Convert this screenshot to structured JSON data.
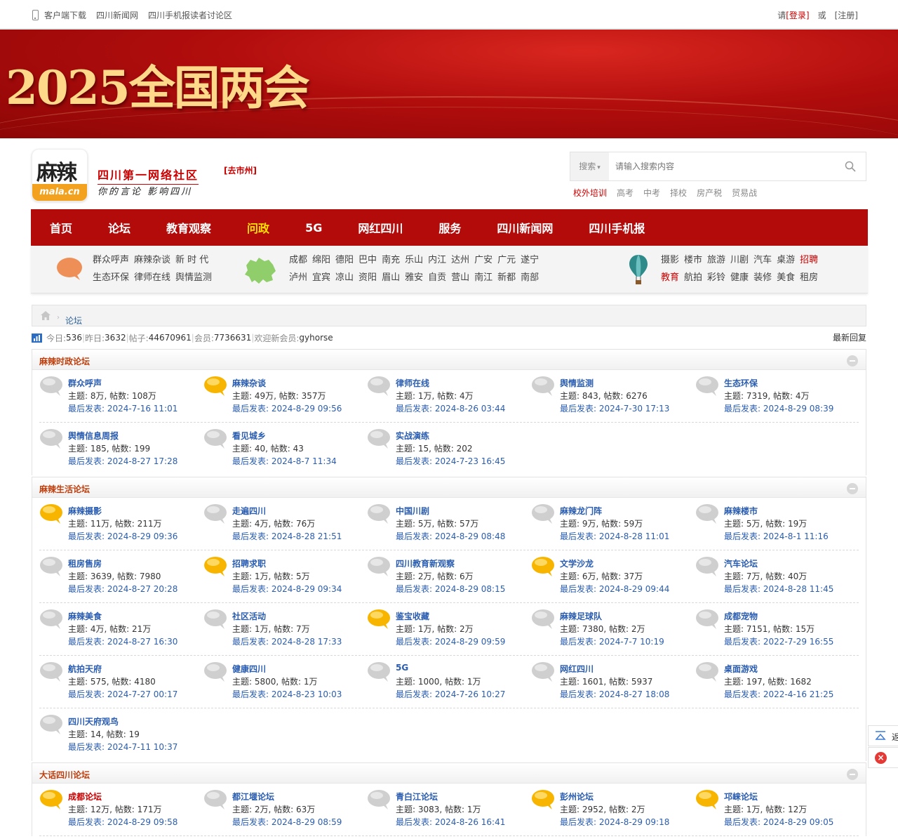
{
  "topbar": {
    "links": [
      "客户端下载",
      "四川新闻网",
      "四川手机报读者讨论区"
    ],
    "please": "请",
    "login": "[登录]",
    "or": "或",
    "register": "[注册]"
  },
  "banner": {
    "title": "2025全国两会"
  },
  "header": {
    "logo_text": "麻辣",
    "logo_domain": "mala.cn",
    "slogan_main": "四川第一网络社区",
    "slogan_sub": "你的言论 影响四川",
    "go_city": "[去市州]",
    "search_type": "搜索",
    "search_placeholder": "请输入搜索内容",
    "hotwords": [
      "校外培训",
      "高考",
      "中考",
      "择校",
      "房产税",
      "贸易战"
    ]
  },
  "nav": [
    "首页",
    "论坛",
    "教育观察",
    "问政",
    "5G",
    "网红四川",
    "服务",
    "四川新闻网",
    "四川手机报"
  ],
  "nav_active": "问政",
  "quick": {
    "group1": [
      [
        "群众呼声",
        "麻辣杂谈",
        "新 时 代"
      ],
      [
        "生态环保",
        "律师在线",
        "舆情监测"
      ]
    ],
    "group2": [
      [
        "成都",
        "绵阳",
        "德阳",
        "巴中",
        "南充",
        "乐山",
        "内江",
        "达州",
        "广安",
        "广元",
        "遂宁"
      ],
      [
        "泸州",
        "宜宾",
        "凉山",
        "资阳",
        "眉山",
        "雅安",
        "自贡",
        "营山",
        "南江",
        "新都",
        "南部"
      ]
    ],
    "group3": [
      [
        "摄影",
        "楼市",
        "旅游",
        "川剧",
        "汽车",
        "桌游",
        "招聘"
      ],
      [
        "教育",
        "航拍",
        "彩铃",
        "健康",
        "装修",
        "美食",
        "租房"
      ]
    ],
    "group3_red": [
      "招聘",
      "教育"
    ]
  },
  "breadcrumb": {
    "current": "论坛"
  },
  "stats": {
    "today_label": "今日: ",
    "today": "536",
    "yesterday_label": "昨日: ",
    "yesterday": "3632",
    "posts_label": "帖子: ",
    "posts": "44670961",
    "members_label": "会员: ",
    "members": "7736631",
    "welcome_label": "欢迎新会员: ",
    "new_member": "gyhorse",
    "latest_reply": "最新回复"
  },
  "sections": [
    {
      "title": "麻辣时政论坛",
      "forums": [
        {
          "name": "群众呼声",
          "stats": "主题: 8万, 帖数: 108万",
          "last": "最后发表: 2024-7-16 11:01",
          "icon": "bubble-gray"
        },
        {
          "name": "麻辣杂谈",
          "stats": "主题: 49万, 帖数: 357万",
          "last": "最后发表: 2024-8-29 09:56",
          "icon": "bubble-yellow"
        },
        {
          "name": "律师在线",
          "stats": "主题: 1万, 帖数: 4万",
          "last": "最后发表: 2024-8-26 03:44",
          "icon": "bubble-gray"
        },
        {
          "name": "舆情监测",
          "stats": "主题: 843, 帖数: 6276",
          "last": "最后发表: 2024-7-30 17:13",
          "icon": "bubble-gray"
        },
        {
          "name": "生态环保",
          "stats": "主题: 7319, 帖数: 4万",
          "last": "最后发表: 2024-8-29 08:39",
          "icon": "bubble-gray"
        },
        {
          "name": "舆情信息周报",
          "stats": "主题: 185, 帖数: 199",
          "last": "最后发表: 2024-8-27 17:28",
          "icon": "bubble-gray"
        },
        {
          "name": "看见城乡",
          "stats": "主题: 40, 帖数: 43",
          "last": "最后发表: 2024-8-7 11:34",
          "icon": "bubble-gray"
        },
        {
          "name": "实战演练",
          "stats": "主题: 15, 帖数: 202",
          "last": "最后发表: 2024-7-23 16:45",
          "icon": "bubble-gray"
        }
      ]
    },
    {
      "title": "麻辣生活论坛",
      "forums": [
        {
          "name": "麻辣摄影",
          "stats": "主题: 11万, 帖数: 211万",
          "last": "最后发表: 2024-8-29 09:36",
          "icon": "bubble-yellow"
        },
        {
          "name": "走遍四川",
          "stats": "主题: 4万, 帖数: 76万",
          "last": "最后发表: 2024-8-28 21:51",
          "icon": "bubble-gray"
        },
        {
          "name": "中国川剧",
          "stats": "主题: 5万, 帖数: 57万",
          "last": "最后发表: 2024-8-29 08:48",
          "icon": "bubble-gray"
        },
        {
          "name": "麻辣龙门阵",
          "stats": "主题: 9万, 帖数: 59万",
          "last": "最后发表: 2024-8-28 11:01",
          "icon": "bubble-gray"
        },
        {
          "name": "麻辣楼市",
          "stats": "主题: 5万, 帖数: 19万",
          "last": "最后发表: 2024-8-1 11:16",
          "icon": "bubble-gray"
        },
        {
          "name": "租房售房",
          "stats": "主题: 3639, 帖数: 7980",
          "last": "最后发表: 2024-8-27 20:28",
          "icon": "bubble-gray"
        },
        {
          "name": "招聘求职",
          "stats": "主题: 1万, 帖数: 5万",
          "last": "最后发表: 2024-8-29 09:34",
          "icon": "bubble-yellow"
        },
        {
          "name": "四川教育新观察",
          "stats": "主题: 2万, 帖数: 6万",
          "last": "最后发表: 2024-8-29 08:15",
          "icon": "bubble-gray"
        },
        {
          "name": "文学沙龙",
          "stats": "主题: 6万, 帖数: 37万",
          "last": "最后发表: 2024-8-29 09:44",
          "icon": "bubble-yellow"
        },
        {
          "name": "汽车论坛",
          "stats": "主题: 7万, 帖数: 40万",
          "last": "最后发表: 2024-8-28 11:45",
          "icon": "bubble-gray"
        },
        {
          "name": "麻辣美食",
          "stats": "主题: 4万, 帖数: 21万",
          "last": "最后发表: 2024-8-27 16:30",
          "icon": "bubble-gray"
        },
        {
          "name": "社区活动",
          "stats": "主题: 1万, 帖数: 7万",
          "last": "最后发表: 2024-8-28 17:33",
          "icon": "bubble-gray"
        },
        {
          "name": "鉴宝收藏",
          "stats": "主题: 1万, 帖数: 2万",
          "last": "最后发表: 2024-8-29 09:59",
          "icon": "bubble-yellow"
        },
        {
          "name": "麻辣足球队",
          "stats": "主题: 7380, 帖数: 2万",
          "last": "最后发表: 2024-7-7 10:19",
          "icon": "bubble-gray"
        },
        {
          "name": "成都宠物",
          "stats": "主题: 7151, 帖数: 15万",
          "last": "最后发表: 2022-7-29 16:55",
          "icon": "bubble-gray"
        },
        {
          "name": "航拍天府",
          "stats": "主题: 575, 帖数: 4180",
          "last": "最后发表: 2024-7-27 00:17",
          "icon": "bubble-gray"
        },
        {
          "name": "健康四川",
          "stats": "主题: 5800, 帖数: 1万",
          "last": "最后发表: 2024-8-23 10:03",
          "icon": "bubble-gray"
        },
        {
          "name": "5G",
          "stats": "主题: 1000, 帖数: 1万",
          "last": "最后发表: 2024-7-26 10:27",
          "icon": "bubble-gray"
        },
        {
          "name": "网红四川",
          "stats": "主题: 1601, 帖数: 5937",
          "last": "最后发表: 2024-8-27 18:08",
          "icon": "bubble-gray"
        },
        {
          "name": "桌面游戏",
          "stats": "主题: 197, 帖数: 1682",
          "last": "最后发表: 2022-4-16 21:25",
          "icon": "bubble-gray"
        },
        {
          "name": "四川天府观鸟",
          "stats": "主题: 14, 帖数: 19",
          "last": "最后发表: 2024-7-11 10:37",
          "icon": "bubble-gray"
        }
      ]
    },
    {
      "title": "大话四川论坛",
      "forums": [
        {
          "name": "成都论坛",
          "stats": "主题: 12万, 帖数: 171万",
          "last": "最后发表: 2024-8-29 09:58",
          "icon": "bubble-yellow",
          "highlight": true
        },
        {
          "name": "都江堰论坛",
          "stats": "主题: 2万, 帖数: 63万",
          "last": "最后发表: 2024-8-29 08:59",
          "icon": "bubble-gray"
        },
        {
          "name": "青白江论坛",
          "stats": "主题: 3083, 帖数: 1万",
          "last": "最后发表: 2024-8-26 16:41",
          "icon": "bubble-gray"
        },
        {
          "name": "彭州论坛",
          "stats": "主题: 2952, 帖数: 2万",
          "last": "最后发表: 2024-8-29 09:18",
          "icon": "bubble-yellow"
        },
        {
          "name": "邛崃论坛",
          "stats": "主题: 1万, 帖数: 12万",
          "last": "最后发表: 2024-8-29 09:05",
          "icon": "bubble-yellow"
        }
      ]
    }
  ],
  "float": {
    "back_top": "返"
  },
  "colors": {
    "nav_bg": "#b30a0a",
    "accent_red": "#cc0000",
    "link_blue": "#2a5db0",
    "section_title": "#c03e0c",
    "nav_active": "#ffe100"
  }
}
